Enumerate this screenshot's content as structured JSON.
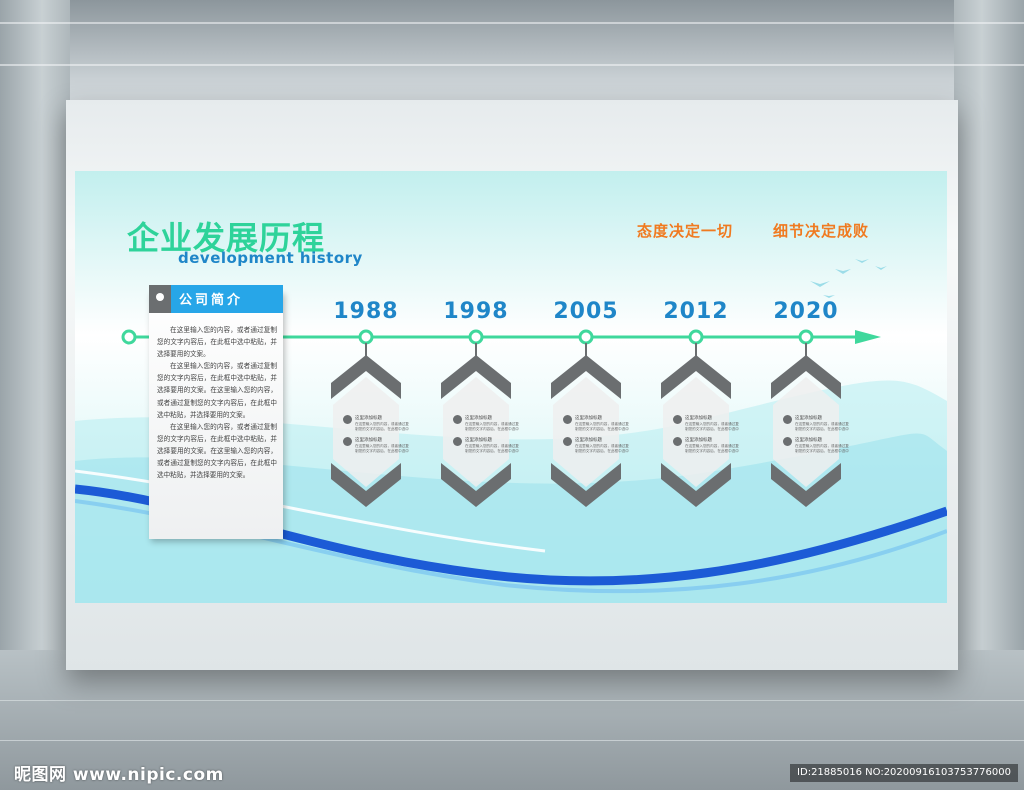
{
  "title": {
    "chinese": "企业发展历程",
    "english": "development history"
  },
  "slogans": [
    "态度决定一切",
    "细节决定成败"
  ],
  "intro": {
    "heading": "公司简介",
    "paragraphs": [
      "在这里输入您的内容，或者通过复制您的文字内容后，在此框中选中粘贴，并选择要用的文案。",
      "在这里输入您的内容，或者通过复制您的文字内容后，在此框中选中粘贴，并选择要用的文案。在这里输入您的内容，或者通过复制您的文字内容后，在此框中选中粘贴，并选择要用的文案。",
      "在这里输入您的内容，或者通过复制您的文字内容后，在此框中选中粘贴，并选择要用的文案。在这里输入您的内容，或者通过复制您的文字内容后，在此框中选中粘贴，并选择要用的文案。"
    ]
  },
  "milestones": [
    {
      "year": "1988",
      "items": [
        {
          "title": "这里添加标题",
          "text": "在这里输入您的内容，或者通过复制您的文字内容后，在此框中选中粘贴"
        },
        {
          "title": "这里添加标题",
          "text": "在这里输入您的内容，或者通过复制您的文字内容后，在此框中选中粘贴"
        }
      ]
    },
    {
      "year": "1998",
      "items": [
        {
          "title": "这里添加标题",
          "text": "在这里输入您的内容，或者通过复制您的文字内容后，在此框中选中粘贴"
        },
        {
          "title": "这里添加标题",
          "text": "在这里输入您的内容，或者通过复制您的文字内容后，在此框中选中粘贴"
        }
      ]
    },
    {
      "year": "2005",
      "items": [
        {
          "title": "这里添加标题",
          "text": "在这里输入您的内容，或者通过复制您的文字内容后，在此框中选中粘贴"
        },
        {
          "title": "这里添加标题",
          "text": "在这里输入您的内容，或者通过复制您的文字内容后，在此框中选中粘贴"
        }
      ]
    },
    {
      "year": "2012",
      "items": [
        {
          "title": "这里添加标题",
          "text": "在这里输入您的内容，或者通过复制您的文字内容后，在此框中选中粘贴"
        },
        {
          "title": "这里添加标题",
          "text": "在这里输入您的内容，或者通过复制您的文字内容后，在此框中选中粘贴"
        }
      ]
    },
    {
      "year": "2020",
      "items": [
        {
          "title": "这里添加标题",
          "text": "在这里输入您的内容，或者通过复制您的文字内容后，在此框中选中粘贴"
        },
        {
          "title": "这里添加标题",
          "text": "在这里输入您的内容，或者通过复制您的文字内容后，在此框中选中粘贴"
        }
      ]
    }
  ],
  "watermark": {
    "site": "昵图网 www.nipic.com",
    "id": "ID:21885016 NO:20200916103753776000"
  },
  "colors": {
    "title_green": "#2ed39a",
    "accent_blue": "#1f86c8",
    "header_blue": "#27a6e8",
    "slogan_orange": "#f07a20",
    "card_gray": "#6b6e70",
    "timeline_green": "#3fd89c"
  }
}
